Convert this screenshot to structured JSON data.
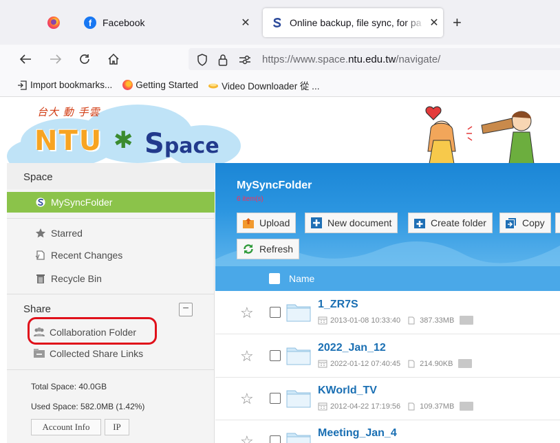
{
  "browser": {
    "tabs": [
      {
        "label": "Facebook",
        "icon": "facebook-icon"
      },
      {
        "label": "Online backup, file sync, for pa",
        "icon": "space-favicon",
        "active": true
      }
    ],
    "url": {
      "prefix": "https://www.space.",
      "host": "ntu.edu.tw",
      "path": "/navigate/"
    },
    "bookmarks": [
      {
        "label": "Import bookmarks...",
        "icon": "import-icon"
      },
      {
        "label": "Getting Started",
        "icon": "firefox-icon"
      },
      {
        "label": "Video Downloader 從 ...",
        "icon": "video-downloader-icon"
      }
    ]
  },
  "site": {
    "logo_tagline": "台大 動 手雲",
    "logo_ntu": "NTU",
    "logo_space_s": "S",
    "logo_space_rest": "pace"
  },
  "sidebar": {
    "space_heading": "Space",
    "active_item": "MySyncFolder",
    "items": [
      "Starred",
      "Recent Changes",
      "Recycle Bin"
    ],
    "share_heading": "Share",
    "collapse_label": "−",
    "share_items": [
      "Collaboration Folder",
      "Collected Share Links"
    ],
    "total_space": "Total Space: 40.0GB",
    "used_space": "Used Space: 582.0MB (1.42%)",
    "buttons": [
      "Account Info",
      "IP"
    ]
  },
  "main": {
    "title": "MySyncFolder",
    "count": "6 item(s)",
    "toolbar": [
      "Upload",
      "New document",
      "Create folder",
      "Copy",
      "Refresh"
    ],
    "column_name": "Name",
    "rows": [
      {
        "name": "1_ZR7S",
        "date": "2013-01-08 10:33:40",
        "size": "387.33MB"
      },
      {
        "name": "2022_Jan_12",
        "date": "2022-01-12 07:40:45",
        "size": "214.90KB"
      },
      {
        "name": "KWorld_TV",
        "date": "2012-04-22 17:19:56",
        "size": "109.37MB"
      },
      {
        "name": "Meeting_Jan_4",
        "date": "",
        "size": ""
      }
    ]
  },
  "colors": {
    "accent_green": "#8bc34a",
    "header_blue": "#1b86d6",
    "highlight_red": "#e0101a"
  }
}
